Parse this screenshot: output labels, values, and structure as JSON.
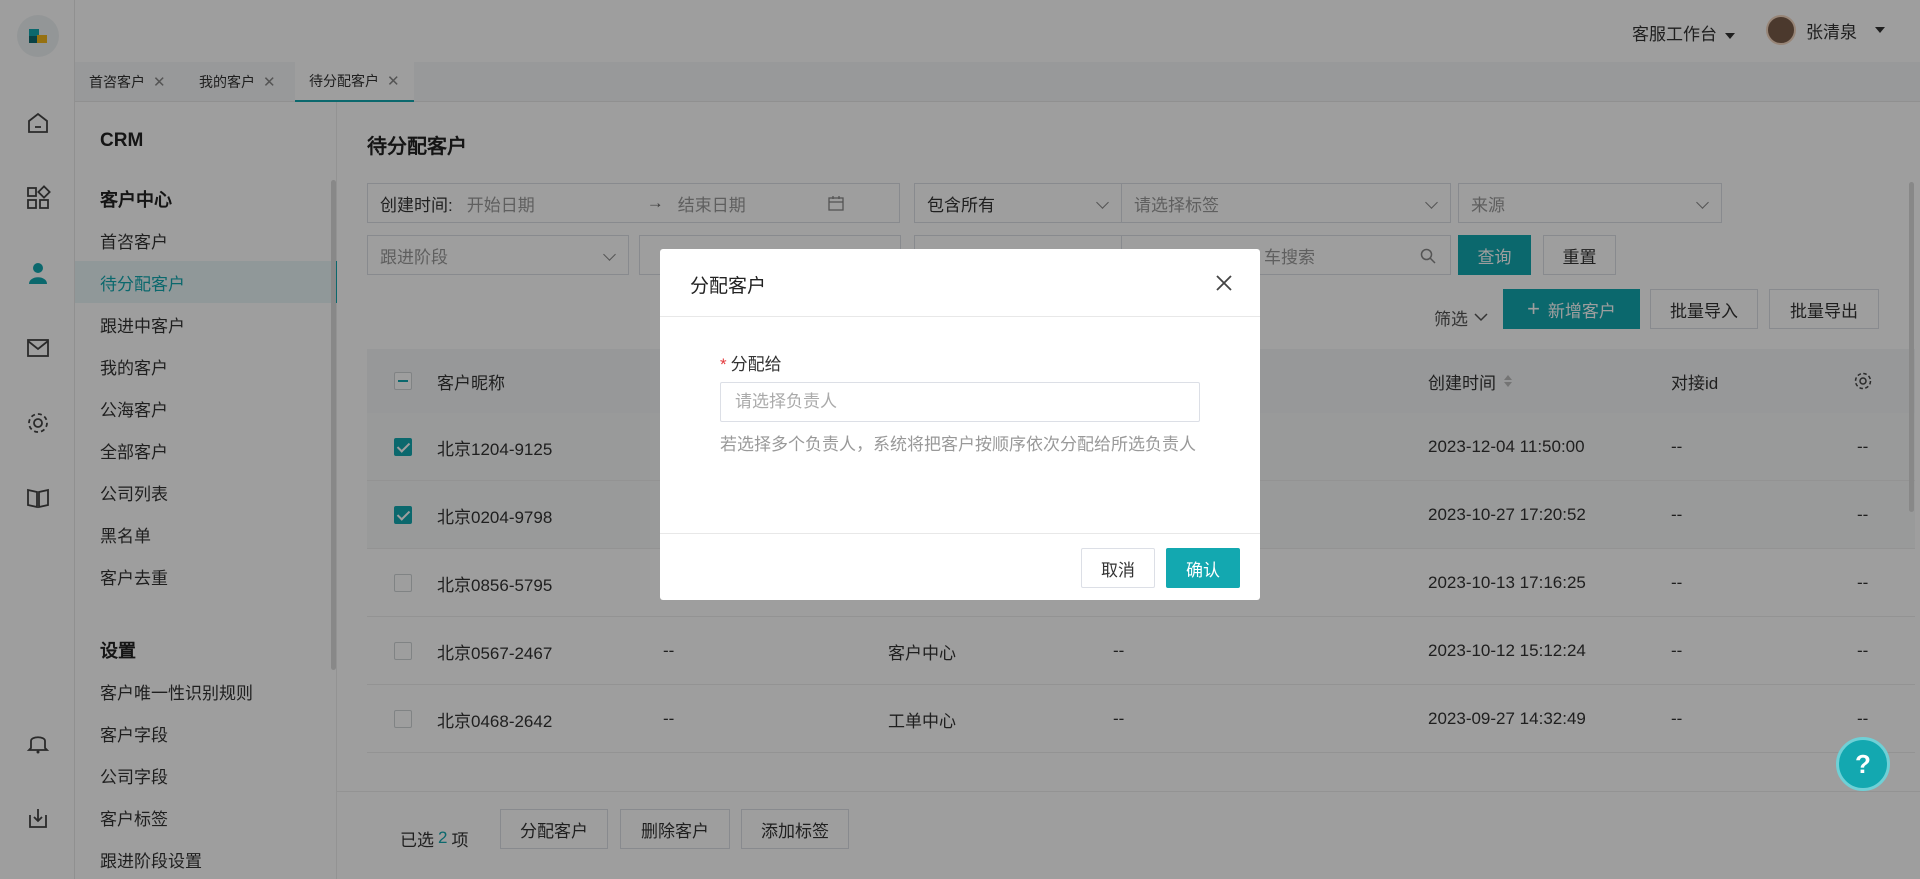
{
  "topbar": {
    "workspace": "客服工作台",
    "user_name": "张清泉"
  },
  "tabs": [
    {
      "label": "首咨客户"
    },
    {
      "label": "我的客户"
    },
    {
      "label": "待分配客户"
    }
  ],
  "sidebar": {
    "app_title": "CRM",
    "section1": "客户中心",
    "items": [
      "首咨客户",
      "待分配客户",
      "跟进中客户",
      "我的客户",
      "公海客户",
      "全部客户",
      "公司列表",
      "黑名单",
      "客户去重"
    ],
    "section2": "设置",
    "settings_items": [
      "客户唯一性识别规则",
      "客户字段",
      "公司字段",
      "客户标签",
      "跟进阶段设置"
    ]
  },
  "page": {
    "title": "待分配客户"
  },
  "filters": {
    "created_label": "创建时间:",
    "start_placeholder": "开始日期",
    "end_placeholder": "结束日期",
    "arrow": "→",
    "include_all": "包含所有",
    "tag_placeholder": "请选择标签",
    "source_placeholder": "来源",
    "stage_placeholder": "跟进阶段",
    "search_visible_text": "车搜索",
    "query_button": "查询",
    "reset_button": "重置"
  },
  "toolbar": {
    "filter": "筛选",
    "add_button": "新增客户",
    "import_button": "批量导入",
    "export_button": "批量导出"
  },
  "table": {
    "columns": [
      "客户昵称",
      "创建时间",
      "对接id"
    ],
    "rows": [
      {
        "checked": true,
        "name": "北京1204-9125",
        "col2": "",
        "col3": "",
        "col4": "",
        "created": "2023-12-04 11:50:00",
        "id": "--",
        "last": "--"
      },
      {
        "checked": true,
        "name": "北京0204-9798",
        "col2": "",
        "col3": "",
        "col4": "",
        "created": "2023-10-27 17:20:52",
        "id": "--",
        "last": "--"
      },
      {
        "checked": false,
        "name": "北京0856-5795",
        "col2": "",
        "col3": "",
        "col4": "",
        "created": "2023-10-13 17:16:25",
        "id": "--",
        "last": "--"
      },
      {
        "checked": false,
        "name": "北京0567-2467",
        "col2": "--",
        "col3": "客户中心",
        "col4": "--",
        "created": "2023-10-12 15:12:24",
        "id": "--",
        "last": "--"
      },
      {
        "checked": false,
        "name": "北京0468-2642",
        "col2": "--",
        "col3": "工单中心",
        "col4": "--",
        "created": "2023-09-27 14:32:49",
        "id": "--",
        "last": "--"
      }
    ]
  },
  "bottom": {
    "selected_prefix": "已选",
    "selected_count": "2",
    "selected_suffix": "项",
    "assign_button": "分配客户",
    "delete_button": "删除客户",
    "tag_button": "添加标签"
  },
  "modal": {
    "title": "分配客户",
    "field_label": "分配给",
    "required_mark": "*",
    "input_placeholder": "请选择负责人",
    "hint": "若选择多个负责人，系统将把客户按顺序依次分配给所选负责人",
    "cancel": "取消",
    "confirm": "确认"
  },
  "colors": {
    "accent": "#13a8b0",
    "required": "#e4393c"
  }
}
